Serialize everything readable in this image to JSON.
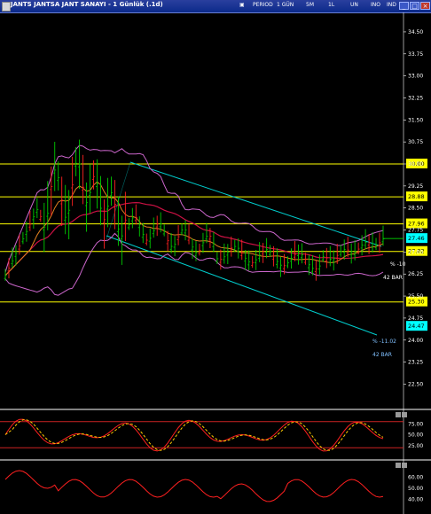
{
  "window": {
    "title": "JANTS JANTSA JANT SANAYI - 1 Günlük (.1d)",
    "toolbar_items": [
      "PERIOD",
      "1 GÜN",
      "5M",
      "1L",
      "UN",
      "INO",
      "IND"
    ]
  },
  "price_axis": {
    "ticks": [
      "34.50",
      "33.75",
      "33.00",
      "32.25",
      "31.50",
      "30.75",
      "30.00",
      "29.25",
      "28.50",
      "27.75",
      "27.00",
      "26.25",
      "25.50",
      "24.75",
      "24.00",
      "23.25",
      "22.50"
    ],
    "min": 22.0,
    "max": 34.8
  },
  "horizontal_levels": [
    {
      "value": "30.00",
      "color": "#ffff00"
    },
    {
      "value": "28.88",
      "color": "#ffff00"
    },
    {
      "value": "27.96",
      "color": "#ffff00"
    },
    {
      "value": "27.02",
      "color": "#ffff00"
    },
    {
      "value": "25.30",
      "color": "#ffff00"
    }
  ],
  "price_markers": [
    {
      "value": "27.46",
      "color": "#00ffff"
    },
    {
      "value": "24.47",
      "color": "#00ffff"
    }
  ],
  "channel_annotations": {
    "upper_pct": "% -10",
    "upper_bars": "42 BAR",
    "lower_pct": "% -11.02",
    "lower_bars": "42 BAR"
  },
  "stochastic_panel": {
    "ticks": [
      "75.00",
      "50.00",
      "25.00"
    ]
  },
  "rsi_panel": {
    "ticks": [
      "60.00",
      "50.00",
      "40.00"
    ]
  },
  "colors": {
    "background": "#000000",
    "up_bar": "#00cc00",
    "down_bar": "#ff2020",
    "bollinger": "#cc66cc",
    "ma_red": "#cc1144",
    "ma_orange": "#e08020",
    "channel": "#00cccc",
    "level_lines": "#ffff00"
  }
}
